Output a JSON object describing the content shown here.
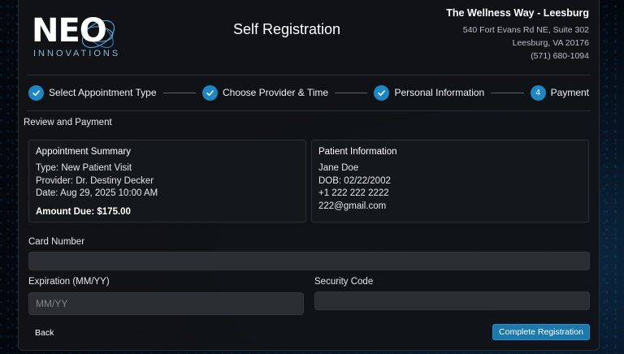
{
  "logo": {
    "word": "NEO",
    "sub": "INNOVATIONS"
  },
  "header": {
    "title": "Self Registration"
  },
  "clinic": {
    "name": "The Wellness Way - Leesburg",
    "address1": "540 Fort Evans Rd NE, Suite 302",
    "address2": "Leesburg, VA 20176",
    "phone": "(571) 680-1094"
  },
  "steps": [
    {
      "label": "Select Appointment Type",
      "status": "complete"
    },
    {
      "label": "Choose Provider & Time",
      "status": "complete"
    },
    {
      "label": "Personal Information",
      "status": "complete"
    },
    {
      "label": "Payment",
      "number": "4",
      "status": "current"
    }
  ],
  "review": {
    "title": "Review and Payment",
    "appointment": {
      "title": "Appointment Summary",
      "type": "Type: New Patient Visit",
      "provider": "Provider: Dr. Destiny Decker",
      "date": "Date: Aug 29, 2025 10:00 AM",
      "amount": "Amount Due: $175.00"
    },
    "patient": {
      "title": "Patient Information",
      "name": "Jane Doe",
      "dob": "DOB: 02/22/2002",
      "phone": "+1 222 222 2222",
      "email": "222@gmail.com"
    }
  },
  "form": {
    "card_label": "Card Number",
    "card_value": "",
    "exp_label": "Expiration (MM/YY)",
    "exp_placeholder": "MM/YY",
    "exp_value": "",
    "sec_label": "Security Code",
    "sec_value": ""
  },
  "buttons": {
    "back": "Back",
    "complete": "Complete Registration"
  },
  "colors": {
    "accent": "#1b87c4",
    "button": "#1b79ae",
    "panel": "#15181b"
  },
  "icons": {
    "step_complete": "checkmark-icon"
  }
}
